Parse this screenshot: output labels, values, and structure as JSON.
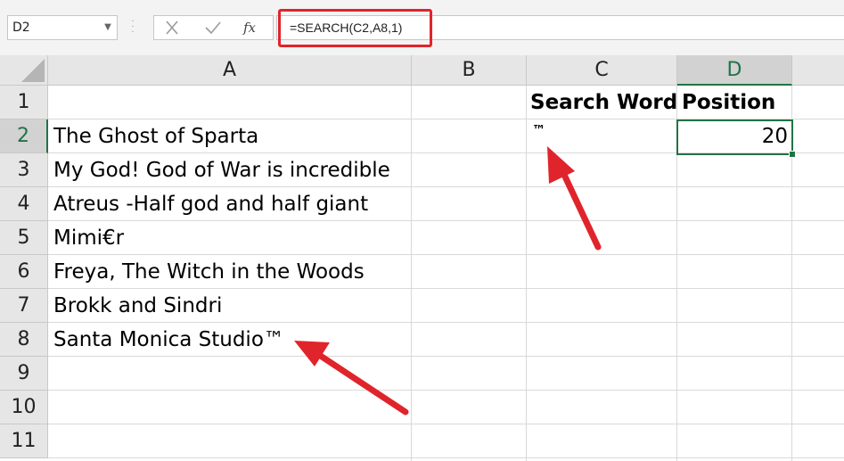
{
  "name_box": {
    "value": "D2"
  },
  "formula_bar": {
    "formula": "=SEARCH(C2,A8,1)",
    "fx_label": "fx"
  },
  "columns": [
    "A",
    "B",
    "C",
    "D"
  ],
  "rows": [
    "1",
    "2",
    "3",
    "4",
    "5",
    "6",
    "7",
    "8",
    "9",
    "10",
    "11"
  ],
  "cells": {
    "C1": "Search Word",
    "D1": "Position",
    "A2": "The Ghost of Sparta",
    "C2": "™",
    "D2": "20",
    "A3": "My God! God of War is incredible",
    "A4": "Atreus -Half god and half giant",
    "A5": "Mimi€r",
    "A6": "Freya, The Witch in the Woods",
    "A7": "Brokk and Sindri",
    "A8": "Santa Monica Studio™"
  },
  "colors": {
    "accent": "#217346",
    "annotation": "#e0242b"
  }
}
